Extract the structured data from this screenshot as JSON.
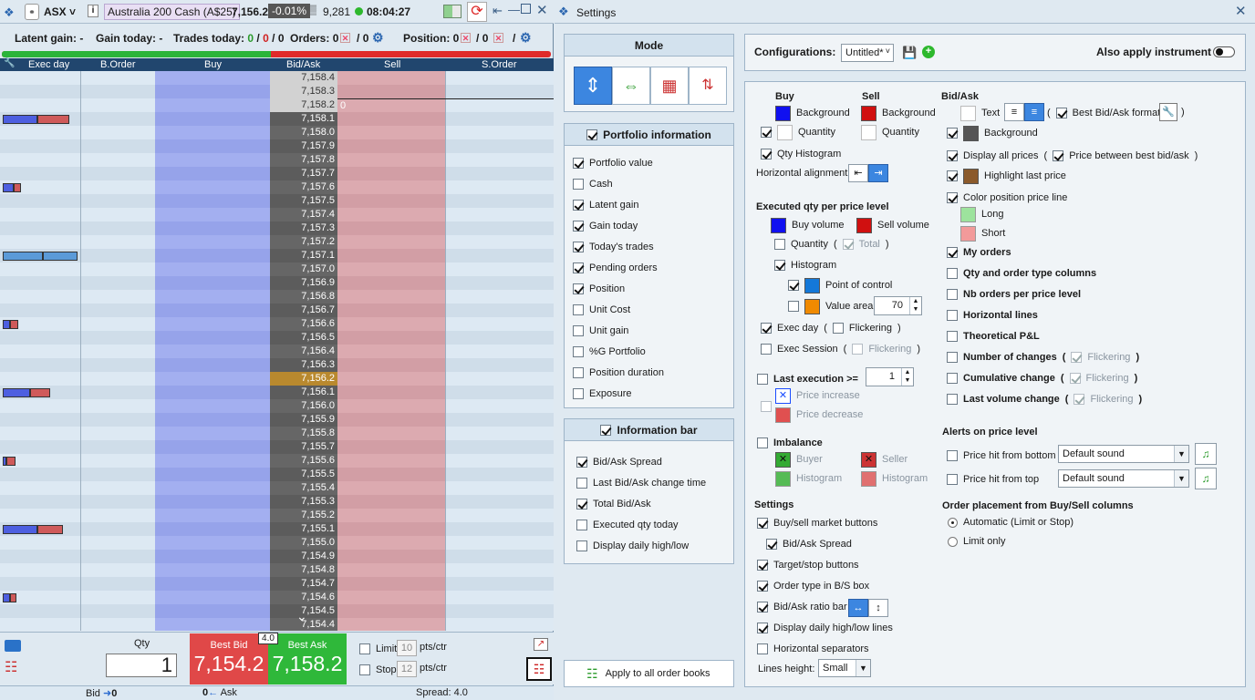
{
  "left": {
    "toolbar": {
      "symbol": "ASX",
      "instrument": "Australia 200 Cash (A$25)",
      "last": "7,156.2",
      "change": "-0.01%",
      "volume": "9,281",
      "time": "08:04:27"
    },
    "status": {
      "latent_gain": "Latent gain: -",
      "gain_today": "Gain today: -",
      "trades_label": "Trades today:",
      "trades_a": "0",
      "trades_b": "0",
      "trades_c": "0",
      "orders_label": "Orders:",
      "orders_a": "0",
      "orders_b": "0",
      "position_label": "Position:",
      "position_a": "0",
      "position_b": "0",
      "sep": "/"
    },
    "columns": [
      "Exec day",
      "B.Order",
      "Buy",
      "Bid/Ask",
      "Sell",
      "S.Order"
    ],
    "prices": [
      "7,158.4",
      "7,158.3",
      "7,158.2",
      "7,158.1",
      "7,158.0",
      "7,157.9",
      "7,157.8",
      "7,157.7",
      "7,157.6",
      "7,157.5",
      "7,157.4",
      "7,157.3",
      "7,157.2",
      "7,157.1",
      "7,157.0",
      "7,156.9",
      "7,156.8",
      "7,156.7",
      "7,156.6",
      "7,156.5",
      "7,156.4",
      "7,156.3",
      "7,156.2",
      "7,156.1",
      "7,156.0",
      "7,155.9",
      "7,155.8",
      "7,155.7",
      "7,155.6",
      "7,155.5",
      "7,155.4",
      "7,155.3",
      "7,155.2",
      "7,155.1",
      "7,155.0",
      "7,154.9",
      "7,154.8",
      "7,154.7",
      "7,154.6",
      "7,154.5",
      "7,154.4"
    ],
    "ask_marker": "0",
    "bottom": {
      "qty_label": "Qty",
      "qty": "1",
      "best_bid_label": "Best Bid",
      "best_bid": "7,154.2",
      "spread_badge": "4.0",
      "best_ask_label": "Best Ask",
      "best_ask": "7,158.2",
      "limit_label": "Limit",
      "limit_val": "10",
      "stop_label": "Stop",
      "stop_val": "12",
      "pts": "pts/ctr"
    },
    "footer": {
      "bid": "Bid",
      "bid_val": "0",
      "ask_val": "0",
      "ask": "Ask",
      "spread": "Spread:  4.0"
    },
    "colors": {
      "bid_bg": "#e04848",
      "ask_bg": "#2fb83a",
      "buy_col": "#9aa8ec",
      "sell_col": "#d9a7ac",
      "price_col": "#5a5a5a",
      "exec_buy": "#4d5fe0",
      "exec_sell": "#cf5a5a"
    }
  },
  "settings": {
    "title": "Settings",
    "mode_title": "Mode",
    "portfolio": {
      "title": "Portfolio information",
      "items": [
        {
          "label": "Portfolio value",
          "on": true
        },
        {
          "label": "Cash",
          "on": false
        },
        {
          "label": "Latent gain",
          "on": true
        },
        {
          "label": "Gain today",
          "on": true
        },
        {
          "label": "Today's trades",
          "on": true
        },
        {
          "label": "Pending orders",
          "on": true
        },
        {
          "label": "Position",
          "on": true
        },
        {
          "label": "Unit Cost",
          "on": false
        },
        {
          "label": "Unit gain",
          "on": false
        },
        {
          "label": "%G Portfolio",
          "on": false
        },
        {
          "label": "Position duration",
          "on": false
        },
        {
          "label": "Exposure",
          "on": false
        }
      ]
    },
    "infobar": {
      "title": "Information bar",
      "items": [
        {
          "label": "Bid/Ask Spread",
          "on": true
        },
        {
          "label": "Last Bid/Ask change time",
          "on": false
        },
        {
          "label": "Total Bid/Ask",
          "on": true
        },
        {
          "label": "Executed qty today",
          "on": false
        },
        {
          "label": "Display daily high/low",
          "on": false
        }
      ]
    },
    "apply_all": "Apply to all order books",
    "config_label": "Configurations:",
    "config_value": "Untitled*",
    "also_apply": "Also apply instrument",
    "buy": "Buy",
    "sell": "Sell",
    "background": "Background",
    "quantity": "Quantity",
    "qty_histogram": "Qty Histogram",
    "horiz_align": "Horizontal alignment",
    "exec_qty_title": "Executed qty per price level",
    "buy_volume": "Buy volume",
    "sell_volume": "Sell volume",
    "ex_quantity": "Quantity",
    "total": "Total",
    "histogram": "Histogram",
    "poc": "Point of control",
    "value_area": "Value area",
    "value_area_val": "70",
    "exec_day": "Exec day",
    "flickering": "Flickering",
    "exec_session": "Exec Session",
    "last_exec": "Last execution >=",
    "last_exec_val": "1",
    "price_increase": "Price increase",
    "price_decrease": "Price decrease",
    "imbalance": "Imbalance",
    "buyer": "Buyer",
    "seller": "Seller",
    "settings_title": "Settings",
    "settings_items": [
      {
        "label": "Buy/sell market buttons",
        "on": true
      },
      {
        "label": "Bid/Ask Spread",
        "on": true
      },
      {
        "label": "Target/stop buttons",
        "on": true
      },
      {
        "label": "Order type in B/S box",
        "on": true
      },
      {
        "label": "Bid/Ask ratio bar",
        "on": true
      },
      {
        "label": "Display daily high/low lines",
        "on": true
      },
      {
        "label": "Horizontal separators",
        "on": false
      }
    ],
    "lines_height": "Lines height:",
    "lines_height_val": "Small",
    "bidask_title": "Bid/Ask",
    "text": "Text",
    "best_format": "Best Bid/Ask format",
    "display_all": "Display all prices",
    "price_between": "Price between best bid/ask",
    "highlight_last": "Highlight last price",
    "color_pos": "Color position price line",
    "long": "Long",
    "short": "Short",
    "right_items": [
      {
        "label": "My orders",
        "on": true
      },
      {
        "label": "Qty and order type columns",
        "on": false
      },
      {
        "label": "Nb orders per price level",
        "on": false
      },
      {
        "label": "Horizontal lines",
        "on": false
      },
      {
        "label": "Theoretical P&L",
        "on": false
      },
      {
        "label": "Number of changes",
        "on": false
      },
      {
        "label": "Cumulative change",
        "on": false
      },
      {
        "label": "Last volume change",
        "on": false
      }
    ],
    "alerts_title": "Alerts on price level",
    "alert_bottom": "Price hit from bottom",
    "alert_top": "Price hit from top",
    "default_sound": "Default sound",
    "placement_title": "Order placement from Buy/Sell columns",
    "auto": "Automatic (Limit or Stop)",
    "limit_only": "Limit only",
    "colors": {
      "blue": "#1010f0",
      "red": "#d01010",
      "grey": "#555555",
      "brown": "#8b5a2b",
      "long": "#9de39d",
      "short": "#f29a9a",
      "poc": "#1478d8",
      "va": "#f08a00",
      "pi": "#1a4cff",
      "pd": "#e05050",
      "buyer": "#33aa33",
      "seller": "#cc3333"
    }
  }
}
